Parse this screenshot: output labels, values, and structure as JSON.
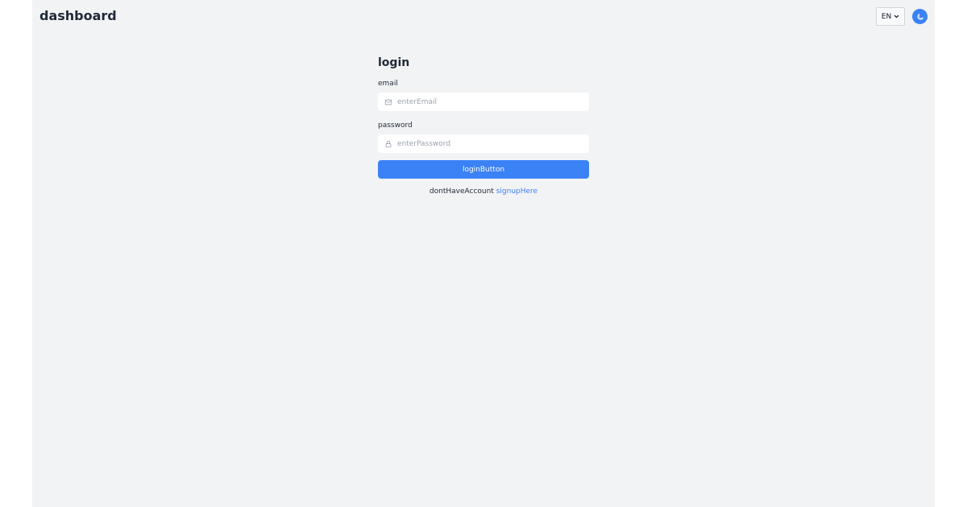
{
  "header": {
    "brand": "dashboard",
    "language": {
      "selected": "EN"
    },
    "theme_toggle": {
      "icon": "moon-icon"
    }
  },
  "login_form": {
    "title": "login",
    "email": {
      "label": "email",
      "placeholder": "enterEmail",
      "value": "",
      "icon": "mail-icon"
    },
    "password": {
      "label": "password",
      "placeholder": "enterPassword",
      "value": "",
      "icon": "lock-icon"
    },
    "submit_label": "loginButton",
    "signup_prompt": "dontHaveAccount",
    "signup_link": "signupHere"
  },
  "colors": {
    "accent": "#3b82f6",
    "background": "#f2f3f5",
    "text": "#1f2937",
    "placeholder": "#9ca3af"
  }
}
